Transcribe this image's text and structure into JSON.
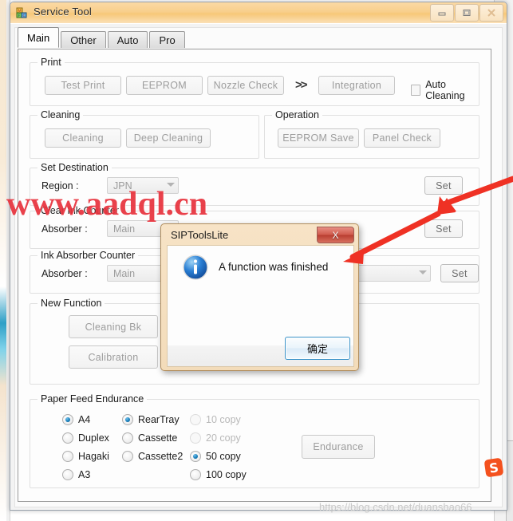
{
  "window": {
    "title": "Service Tool",
    "icon": "blocks-icon",
    "buttons": {
      "minimize": "minimize-icon",
      "maximize": "maximize-icon",
      "close": "close-icon"
    }
  },
  "tabs": [
    {
      "label": "Main",
      "active": true
    },
    {
      "label": "Other",
      "active": false
    },
    {
      "label": "Auto",
      "active": false
    },
    {
      "label": "Pro",
      "active": false
    }
  ],
  "groups": {
    "print": {
      "legend": "Print",
      "buttons": [
        "Test Print",
        "EEPROM",
        "Nozzle Check",
        "Integration"
      ],
      "separator": ">>",
      "checkbox": {
        "label": "Auto Cleaning",
        "checked": false
      }
    },
    "cleaning": {
      "legend": "Cleaning",
      "buttons": [
        "Cleaning",
        "Deep Cleaning"
      ]
    },
    "operation": {
      "legend": "Operation",
      "buttons": [
        "EEPROM Save",
        "Panel Check"
      ]
    },
    "set_destination": {
      "legend": "Set Destination",
      "field_label": "Region :",
      "region_value": "JPN",
      "set_label": "Set"
    },
    "clear_ink_counter": {
      "legend": "Clear Ink Counter",
      "field_label": "Absorber :",
      "absorber_value": "Main",
      "set_label": "Set"
    },
    "ink_absorber_counter": {
      "legend": "Ink Absorber Counter",
      "field_label": "Absorber :",
      "absorber_value": "Main",
      "set_label": "Set"
    },
    "new_function": {
      "legend": "New Function",
      "buttons": [
        "Cleaning Bk",
        "Calibration"
      ]
    },
    "paper_feed": {
      "legend": "Paper Feed Endurance",
      "column1": [
        {
          "label": "A4",
          "selected": true,
          "disabled": false
        },
        {
          "label": "Duplex",
          "selected": false,
          "disabled": false
        },
        {
          "label": "Hagaki",
          "selected": false,
          "disabled": false
        },
        {
          "label": "A3",
          "selected": false,
          "disabled": false
        }
      ],
      "column2": [
        {
          "label": "RearTray",
          "selected": true,
          "disabled": false
        },
        {
          "label": "Cassette",
          "selected": false,
          "disabled": false
        },
        {
          "label": "Cassette2",
          "selected": false,
          "disabled": false
        }
      ],
      "column3": [
        {
          "label": "10 copy",
          "selected": false,
          "disabled": true
        },
        {
          "label": "20 copy",
          "selected": false,
          "disabled": true
        },
        {
          "label": "50 copy",
          "selected": true,
          "disabled": false
        },
        {
          "label": "100 copy",
          "selected": false,
          "disabled": false
        }
      ],
      "action_button": "Endurance"
    }
  },
  "dialog": {
    "title": "SIPToolsLite",
    "message": "A function was finished",
    "ok_label": "确定",
    "close_label": "X",
    "icon": "info-icon"
  },
  "watermarks": {
    "red_text": "www.aadql.cn",
    "csdn_text": "https://blog.csdn.net/duanshao66"
  },
  "colors": {
    "accent_red": "#e8323c",
    "dialog_border": "#b08d5d",
    "titlebar": "#f8cf8c",
    "radio_selected": "#1479b5"
  }
}
